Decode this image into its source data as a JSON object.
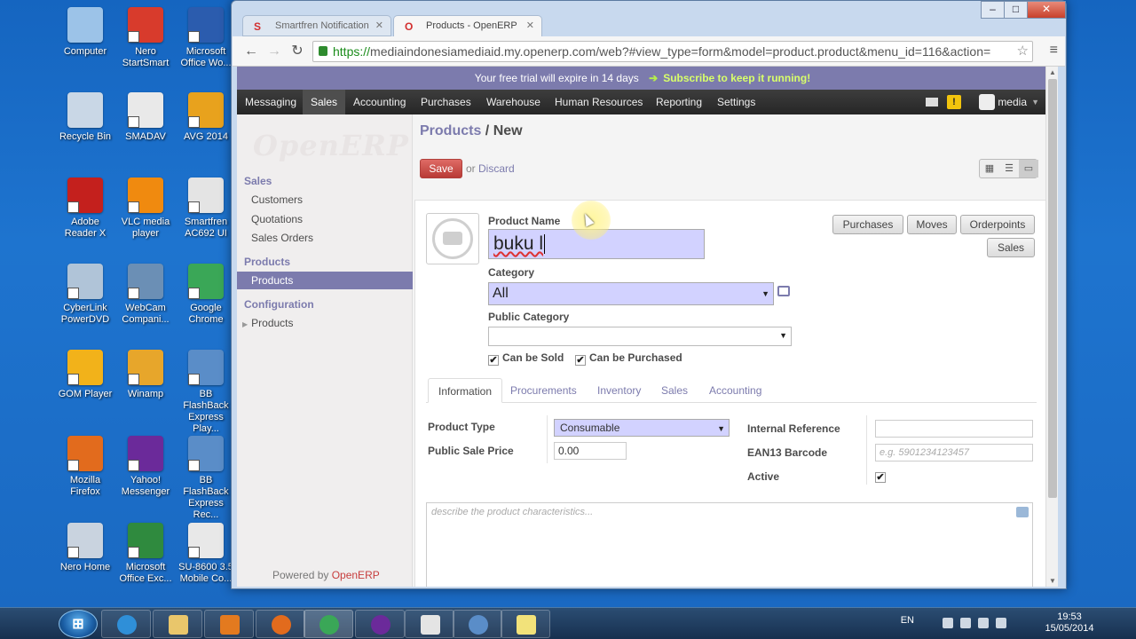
{
  "desktop": {
    "icons": [
      {
        "name": "computer",
        "label": "Computer",
        "color": "#9cc3e8"
      },
      {
        "name": "nero-startsmart",
        "label": "Nero StartSmart",
        "color": "#d83b2c"
      },
      {
        "name": "microsoft-office-word",
        "label": "Microsoft Office Wo...",
        "color": "#2b5cae"
      },
      {
        "name": "recycle-bin",
        "label": "Recycle Bin",
        "color": "#c9d7e6"
      },
      {
        "name": "smadav",
        "label": "SMADAV",
        "color": "#e9e9e9"
      },
      {
        "name": "avg-2014",
        "label": "AVG 2014",
        "color": "#e8a21d"
      },
      {
        "name": "adobe-reader-x",
        "label": "Adobe Reader X",
        "color": "#c4201d"
      },
      {
        "name": "vlc-media-player",
        "label": "VLC media player",
        "color": "#f08a0f"
      },
      {
        "name": "smartfren-ac692",
        "label": "Smartfren AC692 UI",
        "color": "#e4e4e4"
      },
      {
        "name": "cyberlink-powerdvd",
        "label": "CyberLink PowerDVD",
        "color": "#b0c4d8"
      },
      {
        "name": "webcam-companion",
        "label": "WebCam Compani...",
        "color": "#6b8fb5"
      },
      {
        "name": "google-chrome",
        "label": "Google Chrome",
        "color": "#3aa757"
      },
      {
        "name": "gom-player",
        "label": "GOM Player",
        "color": "#f2b21a"
      },
      {
        "name": "winamp",
        "label": "Winamp",
        "color": "#e7a62b"
      },
      {
        "name": "bb-flashback-player",
        "label": "BB FlashBack Express Play...",
        "color": "#5a8dc8"
      },
      {
        "name": "mozilla-firefox",
        "label": "Mozilla Firefox",
        "color": "#e26b1d"
      },
      {
        "name": "yahoo-messenger",
        "label": "Yahoo! Messenger",
        "color": "#6b2a9a"
      },
      {
        "name": "bb-flashback-recorder",
        "label": "BB FlashBack Express Rec...",
        "color": "#5a8dc8"
      },
      {
        "name": "nero-home",
        "label": "Nero Home",
        "color": "#c9d3df"
      },
      {
        "name": "microsoft-office-excel",
        "label": "Microsoft Office Exc...",
        "color": "#2f8a3e"
      },
      {
        "name": "su-8600-mobile",
        "label": "SU-8600 3.5 Mobile Co...",
        "color": "#e8e8e8"
      }
    ]
  },
  "taskbar": {
    "start_label": "⊞",
    "lang": "EN",
    "time": "19:53",
    "date": "15/05/2014"
  },
  "browser": {
    "tabs": [
      {
        "title": "Smartfren Notification",
        "favicon": "S"
      },
      {
        "title": "Products - OpenERP",
        "favicon": "O"
      }
    ],
    "window_controls": {
      "minimize": "–",
      "maximize": "□",
      "close": "✕"
    },
    "url_scheme": "https://",
    "url_rest": "mediaindonesiamediaid.my.openerp.com/web?#view_type=form&model=product.product&menu_id=116&action="
  },
  "app": {
    "trial_notice": "Your free trial will expire in 14 days",
    "subscribe": "Subscribe to keep it running!",
    "menu": [
      "Messaging",
      "Sales",
      "Accounting",
      "Purchases",
      "Warehouse",
      "Human Resources",
      "Reporting",
      "Settings"
    ],
    "active_menu": "Sales",
    "alert_icon": "!",
    "user": "media",
    "logo": "OpenERP",
    "sidebar": {
      "sales_head": "Sales",
      "customers": "Customers",
      "quotations": "Quotations",
      "sales_orders": "Sales Orders",
      "products_head": "Products",
      "products": "Products",
      "configuration_head": "Configuration",
      "config_products": "Products",
      "powered_prefix": "Powered by ",
      "powered_brand": "OpenERP"
    },
    "breadcrumb": {
      "parent": "Products",
      "sep": " / ",
      "current": "New"
    },
    "save": "Save",
    "or": "or",
    "discard": "Discard",
    "form": {
      "product_name_label": "Product Name",
      "product_name_value": "buku l",
      "category_label": "Category",
      "category_value": "All",
      "public_category_label": "Public Category",
      "can_be_sold": "Can be Sold",
      "can_be_purchased": "Can be Purchased",
      "check_mark": "✔",
      "smart_buttons": [
        "Purchases",
        "Moves",
        "Orderpoints",
        "Sales"
      ],
      "notebook_tabs": [
        "Information",
        "Procurements",
        "Inventory",
        "Sales",
        "Accounting"
      ],
      "product_type_label": "Product Type",
      "product_type_value": "Consumable",
      "public_sale_price_label": "Public Sale Price",
      "public_sale_price_value": "0.00",
      "internal_reference_label": "Internal Reference",
      "ean13_label": "EAN13 Barcode",
      "ean13_placeholder": "e.g. 5901234123457",
      "active_label": "Active",
      "description_placeholder": "describe the product characteristics..."
    }
  },
  "colors": {
    "accent": "#7c7bad",
    "save": "#dc5f59",
    "input_required": "#d2d2ff"
  }
}
